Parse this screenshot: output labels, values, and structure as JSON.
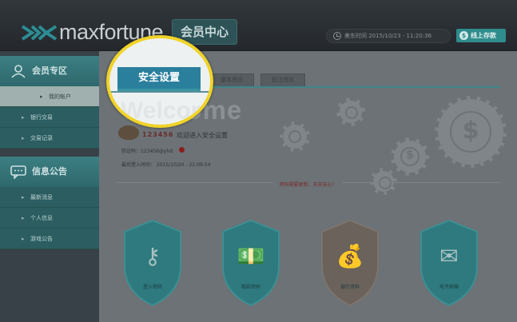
{
  "header": {
    "logo_text": "maxfortune",
    "member_center": "会员中心",
    "datetime": "美东时间 2015/10/23 - 11:20:36",
    "deposit_button": "线上存款"
  },
  "sidebar": {
    "sections": [
      {
        "title": "会员专区",
        "icon": "user-icon",
        "items": [
          "我的帐户",
          "银行交易",
          "交易记录"
        ]
      },
      {
        "title": "信息公告",
        "icon": "chat-icon",
        "items": [
          "最新消息",
          "个人信息",
          "游戏公告"
        ]
      }
    ]
  },
  "tabs": {
    "active": "安全设置",
    "others": [
      "基本资讯",
      "投注资讯"
    ]
  },
  "welcome": {
    "heading": "Welcome",
    "user_id": "123456",
    "message": "欢迎进入安全设置",
    "verify_line": "验证码：123456@yhd",
    "last_login": "最后登入时间： 2015/10/20 - 22:09:54"
  },
  "notice": "密码需要更新，天天安心！",
  "cards": [
    {
      "label": "登入密码",
      "icon": "key-icon",
      "color": "#2e7a7e"
    },
    {
      "label": "取款密码",
      "icon": "money-icon",
      "color": "#2e7a7e"
    },
    {
      "label": "银行资料",
      "icon": "moneybag-icon",
      "color": "#6b625c"
    },
    {
      "label": "电子邮箱",
      "icon": "mail-icon",
      "color": "#2e7a7e"
    }
  ],
  "colors": {
    "accent": "#2a7f9d",
    "highlight_ring": "#f0d32a",
    "teal": "#3c7f83"
  }
}
